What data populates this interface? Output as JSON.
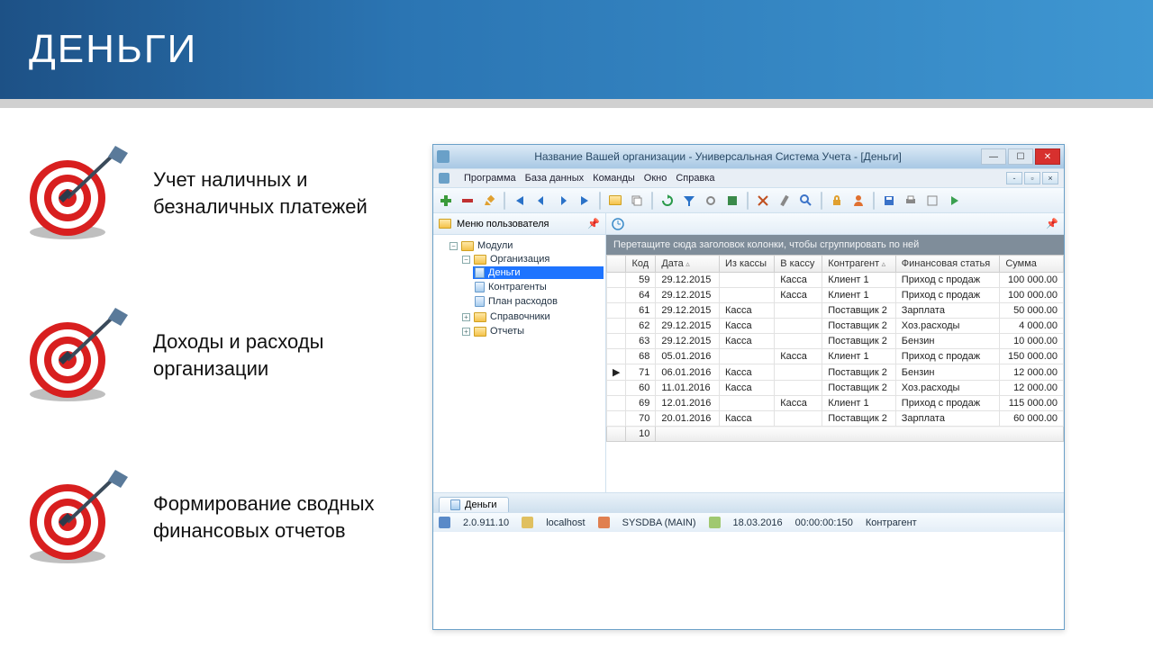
{
  "slide": {
    "title": "ДЕНЬГИ",
    "bullets": [
      "Учет наличных и безналичных платежей",
      "Доходы и расходы организации",
      "Формирование сводных финансовых отчетов"
    ]
  },
  "app": {
    "title": "Название Вашей организации - Универсальная Система Учета - [Деньги]",
    "menu": [
      "Программа",
      "База данных",
      "Команды",
      "Окно",
      "Справка"
    ],
    "sidebar_header": "Меню пользователя",
    "tree": {
      "root": "Модули",
      "org": "Организация",
      "org_children": [
        "Деньги",
        "Контрагенты",
        "План расходов"
      ],
      "others": [
        "Справочники",
        "Отчеты"
      ]
    },
    "group_hint": "Перетащите сюда заголовок колонки, чтобы сгруппировать по ней",
    "columns": [
      "Код",
      "Дата",
      "Из кассы",
      "В кассу",
      "Контрагент",
      "Финансовая статья",
      "Сумма"
    ],
    "rows": [
      {
        "mark": "",
        "code": "59",
        "date": "29.12.2015",
        "from": "",
        "to": "Касса",
        "agent": "Клиент 1",
        "article": "Приход с продаж",
        "sum": "100 000.00"
      },
      {
        "mark": "",
        "code": "64",
        "date": "29.12.2015",
        "from": "",
        "to": "Касса",
        "agent": "Клиент 1",
        "article": "Приход с продаж",
        "sum": "100 000.00"
      },
      {
        "mark": "",
        "code": "61",
        "date": "29.12.2015",
        "from": "Касса",
        "to": "",
        "agent": "Поставщик 2",
        "article": "Зарплата",
        "sum": "50 000.00"
      },
      {
        "mark": "",
        "code": "62",
        "date": "29.12.2015",
        "from": "Касса",
        "to": "",
        "agent": "Поставщик 2",
        "article": "Хоз.расходы",
        "sum": "4 000.00"
      },
      {
        "mark": "",
        "code": "63",
        "date": "29.12.2015",
        "from": "Касса",
        "to": "",
        "agent": "Поставщик 2",
        "article": "Бензин",
        "sum": "10 000.00"
      },
      {
        "mark": "",
        "code": "68",
        "date": "05.01.2016",
        "from": "",
        "to": "Касса",
        "agent": "Клиент 1",
        "article": "Приход с продаж",
        "sum": "150 000.00"
      },
      {
        "mark": "▶",
        "code": "71",
        "date": "06.01.2016",
        "from": "Касса",
        "to": "",
        "agent": "Поставщик 2",
        "article": "Бензин",
        "sum": "12 000.00"
      },
      {
        "mark": "",
        "code": "60",
        "date": "11.01.2016",
        "from": "Касса",
        "to": "",
        "agent": "Поставщик 2",
        "article": "Хоз.расходы",
        "sum": "12 000.00"
      },
      {
        "mark": "",
        "code": "69",
        "date": "12.01.2016",
        "from": "",
        "to": "Касса",
        "agent": "Клиент 1",
        "article": "Приход с продаж",
        "sum": "115 000.00"
      },
      {
        "mark": "",
        "code": "70",
        "date": "20.01.2016",
        "from": "Касса",
        "to": "",
        "agent": "Поставщик 2",
        "article": "Зарплата",
        "sum": "60 000.00"
      }
    ],
    "row_count": "10",
    "tab": "Деньги",
    "status": {
      "version": "2.0.911.10",
      "host": "localhost",
      "user": "SYSDBA (MAIN)",
      "date": "18.03.2016",
      "time": "00:00:00:150",
      "extra": "Контрагент"
    }
  }
}
